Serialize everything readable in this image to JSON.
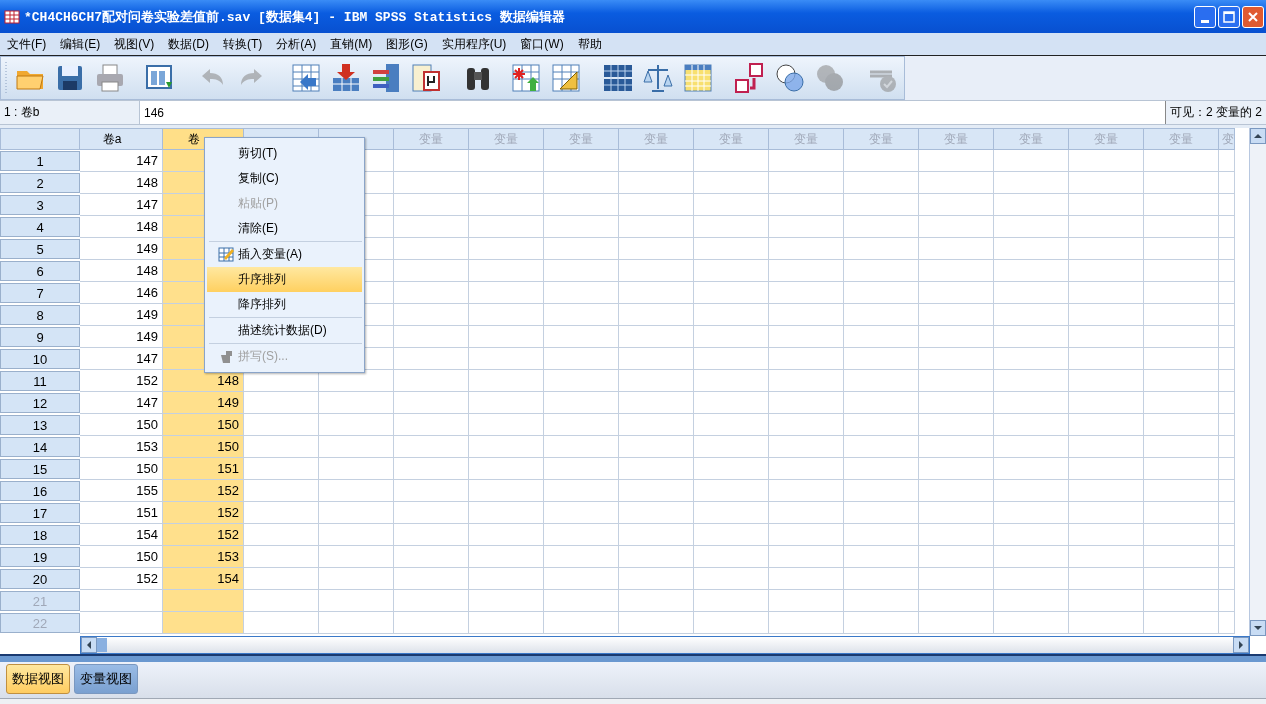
{
  "window": {
    "title": "*CH4CH6CH7配对问卷实验差值前.sav [数据集4] - IBM SPSS Statistics 数据编辑器"
  },
  "menu_bar": [
    "文件(F)",
    "编辑(E)",
    "视图(V)",
    "数据(D)",
    "转换(T)",
    "分析(A)",
    "直销(M)",
    "图形(G)",
    "实用程序(U)",
    "窗口(W)",
    "帮助"
  ],
  "toolbar": [
    {
      "disabled": false
    },
    {
      "disabled": false
    },
    {
      "disabled": false
    },
    {
      "disabled": false
    },
    {
      "disabled": true
    },
    {
      "disabled": true
    },
    {
      "disabled": false
    },
    {
      "disabled": false
    },
    {
      "disabled": false
    },
    {
      "disabled": false
    },
    {
      "disabled": false
    },
    {
      "disabled": false
    },
    {
      "disabled": false
    },
    {
      "disabled": false
    },
    {
      "disabled": false
    },
    {
      "disabled": false
    },
    {
      "disabled": false
    },
    {
      "disabled": false
    },
    {
      "disabled": true
    },
    {
      "disabled": true
    }
  ],
  "cell_editor": {
    "cell": "1 : 卷b",
    "value": "146",
    "visible": "可见：2 变量的 2"
  },
  "columns": [
    {
      "label": "卷a",
      "kind": "variable",
      "selected": false
    },
    {
      "label": "卷",
      "kind": "variable",
      "selected": true
    },
    {
      "kind": "empty",
      "selected": false
    },
    {
      "kind": "empty",
      "selected": false
    },
    {
      "label": "变量",
      "kind": "empty",
      "selected": false
    },
    {
      "label": "变量",
      "kind": "empty",
      "selected": false
    },
    {
      "label": "变量",
      "kind": "empty",
      "selected": false
    },
    {
      "label": "变量",
      "kind": "empty",
      "selected": false
    },
    {
      "label": "变量",
      "kind": "empty",
      "selected": false
    },
    {
      "label": "变量",
      "kind": "empty",
      "selected": false
    },
    {
      "label": "变量",
      "kind": "empty",
      "selected": false
    },
    {
      "label": "变量",
      "kind": "empty",
      "selected": false
    },
    {
      "label": "变量",
      "kind": "empty",
      "selected": false
    },
    {
      "label": "变量",
      "kind": "empty",
      "selected": false
    },
    {
      "label": "变量",
      "kind": "empty",
      "selected": false
    },
    {
      "label": "变",
      "kind": "empty",
      "selected": false
    }
  ],
  "rows": [
    {
      "num": "1",
      "a": "147",
      "disabled": false
    },
    {
      "num": "2",
      "a": "148",
      "disabled": false
    },
    {
      "num": "3",
      "a": "147",
      "disabled": false
    },
    {
      "num": "4",
      "a": "148",
      "disabled": false
    },
    {
      "num": "5",
      "a": "149",
      "disabled": false
    },
    {
      "num": "6",
      "a": "148",
      "disabled": false
    },
    {
      "num": "7",
      "a": "146",
      "disabled": false
    },
    {
      "num": "8",
      "a": "149",
      "disabled": false
    },
    {
      "num": "9",
      "a": "149",
      "disabled": false
    },
    {
      "num": "10",
      "a": "147",
      "disabled": false
    },
    {
      "num": "11",
      "a": "152",
      "b": "148",
      "disabled": false
    },
    {
      "num": "12",
      "a": "147",
      "b": "149",
      "disabled": false
    },
    {
      "num": "13",
      "a": "150",
      "b": "150",
      "disabled": false
    },
    {
      "num": "14",
      "a": "153",
      "b": "150",
      "disabled": false
    },
    {
      "num": "15",
      "a": "150",
      "b": "151",
      "disabled": false
    },
    {
      "num": "16",
      "a": "155",
      "b": "152",
      "disabled": false
    },
    {
      "num": "17",
      "a": "151",
      "b": "152",
      "disabled": false
    },
    {
      "num": "18",
      "a": "154",
      "b": "152",
      "disabled": false
    },
    {
      "num": "19",
      "a": "150",
      "b": "153",
      "disabled": false
    },
    {
      "num": "20",
      "a": "152",
      "b": "154",
      "disabled": false
    },
    {
      "num": "21",
      "disabled": true
    },
    {
      "num": "22",
      "disabled": true
    }
  ],
  "context_menu": [
    {
      "kind": "item",
      "label": "剪切(T)",
      "disabled": false,
      "selected": false
    },
    {
      "kind": "item",
      "label": "复制(C)",
      "disabled": false,
      "selected": false
    },
    {
      "kind": "item",
      "label": "粘贴(P)",
      "disabled": true,
      "selected": false
    },
    {
      "kind": "item",
      "label": "清除(E)",
      "disabled": false,
      "selected": false
    },
    {
      "kind": "separator"
    },
    {
      "kind": "item",
      "label": "插入变量(A)",
      "disabled": false,
      "selected": false
    },
    {
      "kind": "item",
      "label": "升序排列",
      "disabled": false,
      "selected": true
    },
    {
      "kind": "item",
      "label": "降序排列",
      "disabled": false,
      "selected": false
    },
    {
      "kind": "separator"
    },
    {
      "kind": "item",
      "label": "描述统计数据(D)",
      "disabled": false,
      "selected": false
    },
    {
      "kind": "separator"
    },
    {
      "kind": "item",
      "label": "拼写(S)...",
      "disabled": true,
      "selected": false
    }
  ],
  "view_tabs": [
    {
      "label": "数据视图",
      "selected": true
    },
    {
      "label": "变量视图",
      "selected": false
    }
  ]
}
